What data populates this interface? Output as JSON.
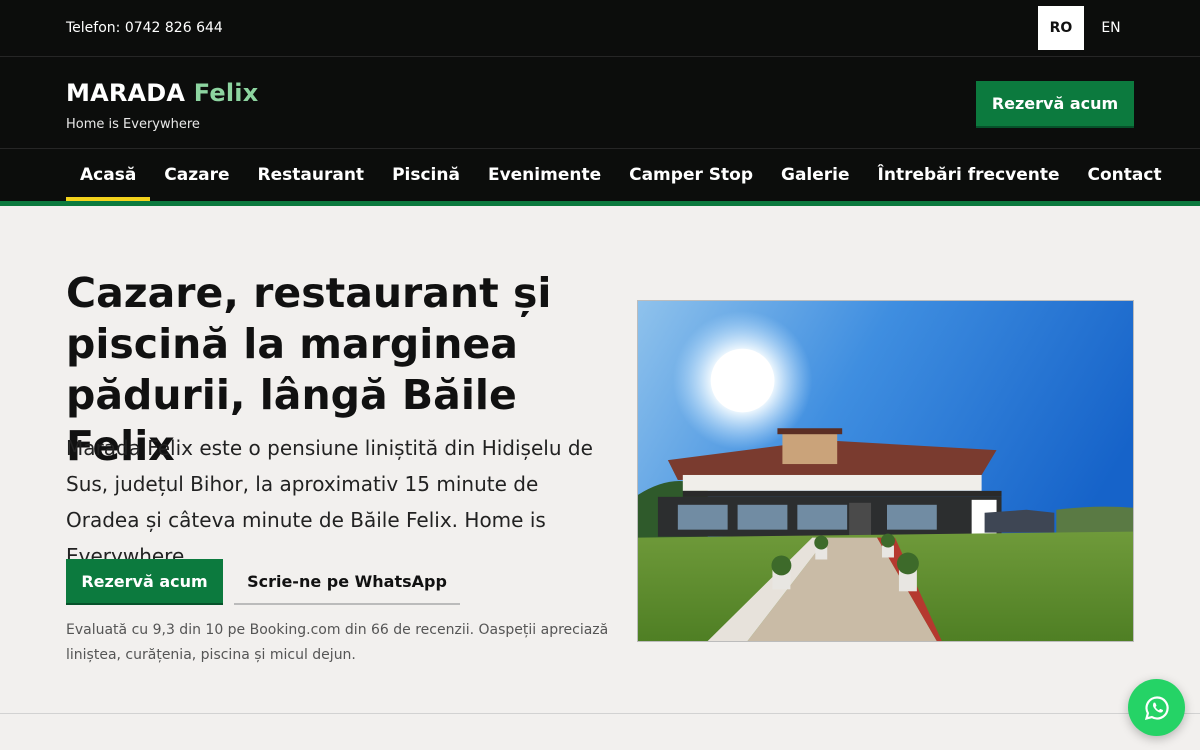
{
  "topbar": {
    "phone": "Telefon: 0742 826 644",
    "languages": [
      {
        "label": "RO",
        "active": true
      },
      {
        "label": "EN",
        "active": false
      }
    ]
  },
  "header": {
    "brand_main": "MARADA",
    "brand_accent": "Felix",
    "tagline": "Home is Everywhere",
    "cta": "Rezervă acum"
  },
  "nav": {
    "items": [
      {
        "label": "Acasă",
        "active": true
      },
      {
        "label": "Cazare"
      },
      {
        "label": "Restaurant"
      },
      {
        "label": "Piscină"
      },
      {
        "label": "Evenimente"
      },
      {
        "label": "Camper Stop"
      },
      {
        "label": "Galerie"
      },
      {
        "label": "Întrebări frecvente"
      },
      {
        "label": "Contact"
      }
    ]
  },
  "hero": {
    "title": "Cazare, restaurant și piscină la marginea pădurii, lângă Băile Felix",
    "description": "Marada Felix este o pensiune liniștită din Hidișelu de Sus, județul Bihor, la aproximativ 15 minute de Oradea și câteva minute de Băile Felix. Home is Everywhere.",
    "primary_button": "Rezervă acum",
    "secondary_button": "Scrie-ne pe WhatsApp",
    "rating_note": "Evaluată cu 9,3 din 10 pe Booking.com din 66 de recenzii. Oaspeții apreciază liniștea, curățenia, piscina și micul dejun."
  },
  "fab": {
    "icon": "whatsapp-icon"
  },
  "colors": {
    "brand_green": "#0c7a3e",
    "accent_green": "#8dd4a0",
    "nav_active_underline": "#f3d21c",
    "dark_bg": "#0c0d0c",
    "whatsapp": "#25d366"
  }
}
